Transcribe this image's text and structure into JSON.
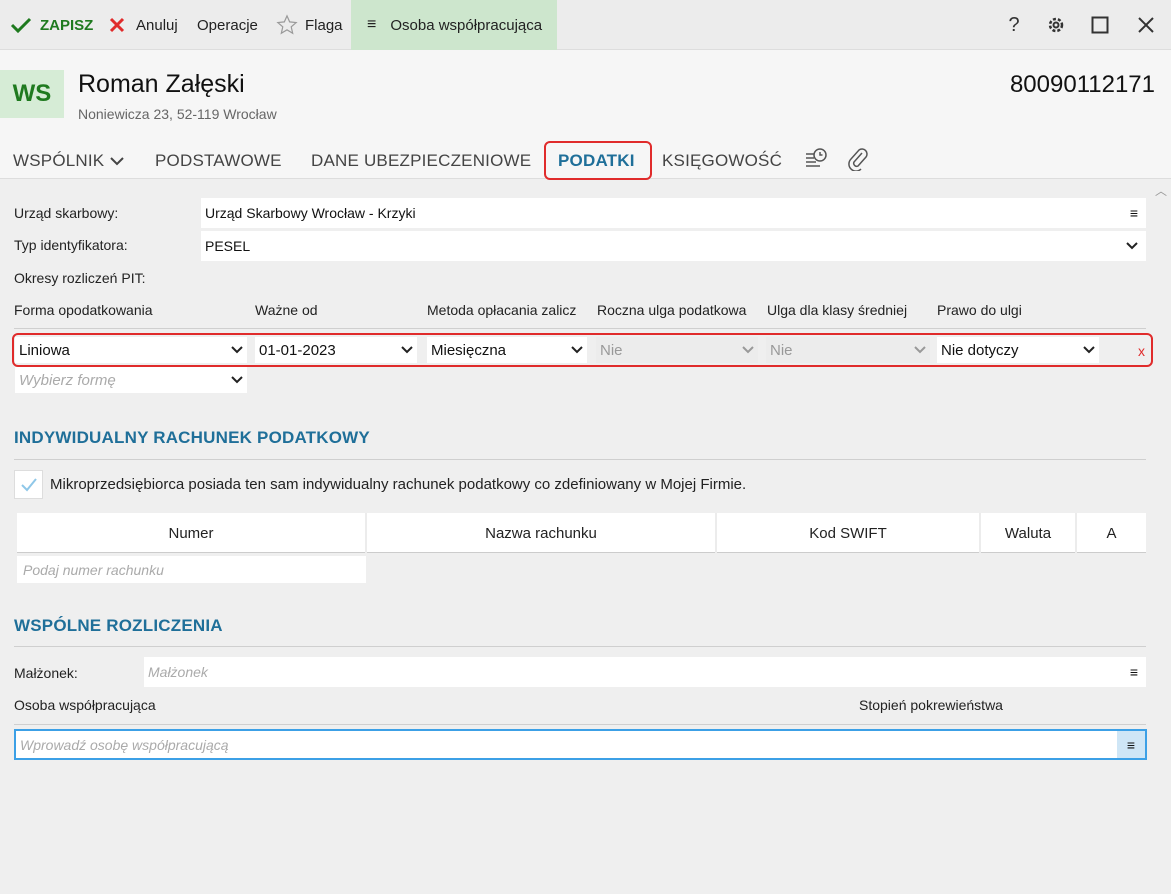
{
  "toolbar": {
    "save_label": "ZAPISZ",
    "cancel_label": "Anuluj",
    "operations_label": "Operacje",
    "flag_label": "Flaga",
    "osoba_label": "Osoba współpracująca",
    "accent_color": "#1f7a1f",
    "active_bg": "#cde6cd"
  },
  "header": {
    "avatar_initials": "WS",
    "name": "Roman Załęski",
    "address": "Noniewicza 23, 52-119 Wrocław",
    "id_number": "80090112171"
  },
  "tabs": [
    {
      "label": "WSPÓLNIK"
    },
    {
      "label": "PODSTAWOWE"
    },
    {
      "label": "DANE UBEZPIECZENIOWE"
    },
    {
      "label": "PODATKI",
      "active": true
    },
    {
      "label": "KSIĘGOWOŚĆ"
    }
  ],
  "form": {
    "urzad_label": "Urząd skarbowy:",
    "urzad_value": "Urząd Skarbowy Wrocław - Krzyki",
    "typ_label": "Typ identyfikatora:",
    "typ_value": "PESEL",
    "okresy_label": "Okresy rozliczeń PIT:"
  },
  "pit_table": {
    "columns": [
      "Forma opodatkowania",
      "Ważne od",
      "Metoda opłacania zalicz",
      "Roczna ulga podatkowa",
      "Ulga dla klasy średniej",
      "Prawo do ulgi"
    ],
    "row": {
      "forma": "Liniowa",
      "wazne_od": "01-01-2023",
      "metoda": "Miesięczna",
      "roczna_ulga": "Nie",
      "ulga_klasy": "Nie",
      "prawo": "Nie dotyczy",
      "delete": "x"
    },
    "new_row_placeholder": "Wybierz formę"
  },
  "irp": {
    "title": "INDYWIDUALNY RACHUNEK PODATKOWY",
    "checkbox_label": "Mikroprzedsiębiorca posiada ten sam indywidualny rachunek podatkowy co zdefiniowany w Mojej Firmie.",
    "checked": true,
    "columns": [
      "Numer",
      "Nazwa rachunku",
      "Kod SWIFT",
      "Waluta",
      "A"
    ],
    "number_placeholder": "Podaj numer rachunku"
  },
  "wspolne": {
    "title": "WSPÓLNE ROZLICZENIA",
    "malzonek_label": "Małżonek:",
    "malzonek_placeholder": "Małżonek",
    "osoba_col": "Osoba współpracująca",
    "stopien_col": "Stopień pokrewieństwa",
    "osoba_placeholder": "Wprowadź osobę współpracującą"
  }
}
